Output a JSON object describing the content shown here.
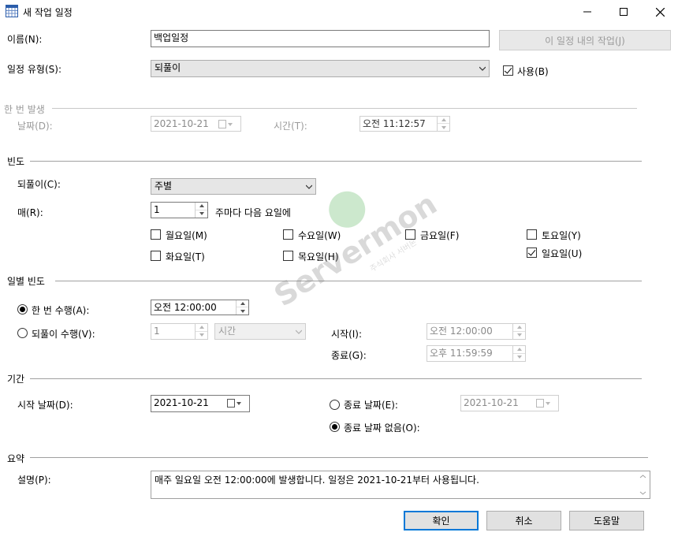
{
  "window": {
    "title": "새 작업 일정",
    "icon": "calendar-grid-icon",
    "min_icon": "minimize-icon",
    "max_icon": "maximize-icon",
    "close_icon": "close-icon"
  },
  "name": {
    "label": "이름(N):",
    "value": "백업일정"
  },
  "jobs_in_schedule_button": "이 일정 내의 작업(J)",
  "schedule_type": {
    "label": "일정 유형(S):",
    "value": "되풀이"
  },
  "enabled": {
    "label": "사용(B)",
    "checked": true
  },
  "one_time": {
    "section": "한 번 발생",
    "date_label": "날짜(D):",
    "date_value": "2021-10-21",
    "time_label": "시간(T):",
    "time_value": "오전 11:12:57"
  },
  "frequency": {
    "section": "빈도",
    "occurs_label": "되풀이(C):",
    "occurs_value": "주별",
    "recurs_label": "매(R):",
    "recurs_value": "1",
    "recurs_suffix": "주마다 다음 요일에",
    "days": {
      "mon": {
        "label": "월요일(M)",
        "checked": false
      },
      "tue": {
        "label": "화요일(T)",
        "checked": false
      },
      "wed": {
        "label": "수요일(W)",
        "checked": false
      },
      "thu": {
        "label": "목요일(H)",
        "checked": false
      },
      "fri": {
        "label": "금요일(F)",
        "checked": false
      },
      "sat": {
        "label": "토요일(Y)",
        "checked": false
      },
      "sun": {
        "label": "일요일(U)",
        "checked": true
      }
    }
  },
  "daily": {
    "section": "일별 빈도",
    "once_label": "한 번 수행(A):",
    "once_selected": true,
    "once_time": "오전 12:00:00",
    "every_label": "되풀이 수행(V):",
    "every_selected": false,
    "every_value": "1",
    "every_unit": "시간",
    "start_label": "시작(I):",
    "start_value": "오전 12:00:00",
    "end_label": "종료(G):",
    "end_value": "오후 11:59:59"
  },
  "duration": {
    "section": "기간",
    "start_label": "시작 날짜(D):",
    "start_value": "2021-10-21",
    "end_date_label": "종료 날짜(E):",
    "end_date_selected": false,
    "end_date_value": "2021-10-21",
    "no_end_label": "종료 날짜 없음(O):",
    "no_end_selected": true
  },
  "summary": {
    "section": "요약",
    "desc_label": "설명(P):",
    "desc_value": "매주 일요일 오전 12:00:00에 발생합니다. 일정은 2021-10-21부터 사용됩니다."
  },
  "buttons": {
    "ok": "확인",
    "cancel": "취소",
    "help": "도움말"
  },
  "watermark": {
    "text": "Servermon",
    "sub": "주식회사 서버몬"
  }
}
